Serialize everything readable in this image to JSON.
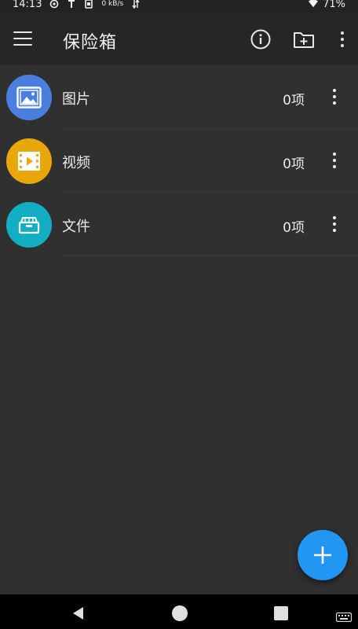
{
  "status_bar": {
    "time": "14:13",
    "net_speed": "0 kB/s",
    "battery": "71%"
  },
  "app_bar": {
    "title": "保险箱",
    "icons": [
      "menu-icon",
      "info-icon",
      "folder-add-icon",
      "more-vert-icon"
    ]
  },
  "items": [
    {
      "label": "图片",
      "count": "0项",
      "icon": "image-icon",
      "color": "#4a7fe0"
    },
    {
      "label": "视频",
      "count": "0项",
      "icon": "video-icon",
      "color": "#e8a80c"
    },
    {
      "label": "文件",
      "count": "0项",
      "icon": "file-box-icon",
      "color": "#12afc4"
    }
  ],
  "fab": {
    "icon": "plus-icon",
    "color": "#2196f3"
  },
  "nav_bar": {
    "icons": [
      "back-icon",
      "home-icon",
      "recents-icon",
      "keyboard-icon"
    ]
  }
}
